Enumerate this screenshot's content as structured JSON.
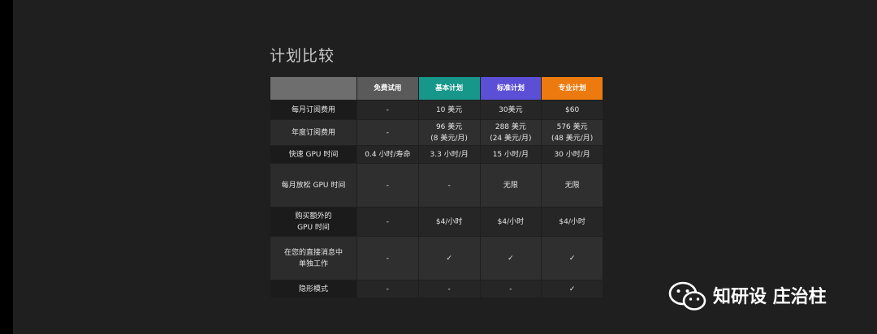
{
  "title": "计划比较",
  "table": {
    "headers": [
      "",
      "免费试用",
      "基本计划",
      "标准计划",
      "专业计划"
    ],
    "header_colors": {
      "corner": "#6e6e6e",
      "free": "#5a5a5a",
      "basic": "#17968a",
      "standard": "#5b4fd6",
      "pro": "#ec7a0e"
    },
    "rows": [
      {
        "label": "每月订阅费用",
        "values": [
          "-",
          "10 美元",
          "30美元",
          "$60"
        ]
      },
      {
        "label": "年度订阅费用",
        "values": [
          "-",
          "96 美元\n(8 美元/月)",
          "288 美元\n(24 美元/月)",
          "576 美元\n(48 美元/月)"
        ]
      },
      {
        "label": "快速 GPU 时间",
        "values": [
          "0.4 小时/寿命",
          "3.3 小时/月",
          "15 小时/月",
          "30 小时/月"
        ]
      },
      {
        "label": "每月放松 GPU 时间",
        "values": [
          "-",
          "-",
          "无限",
          "无限"
        ]
      },
      {
        "label": "购买额外的\nGPU 时间",
        "values": [
          "-",
          "$4/小时",
          "$4/小时",
          "$4/小时"
        ]
      },
      {
        "label": "在您的直接消息中\n单独工作",
        "values": [
          "-",
          "✓",
          "✓",
          "✓"
        ]
      },
      {
        "label": "隐形模式",
        "values": [
          "-",
          "-",
          "-",
          "✓"
        ]
      }
    ]
  },
  "watermark": {
    "text": "知研设 庄治柱",
    "icon": "wechat-icon"
  }
}
